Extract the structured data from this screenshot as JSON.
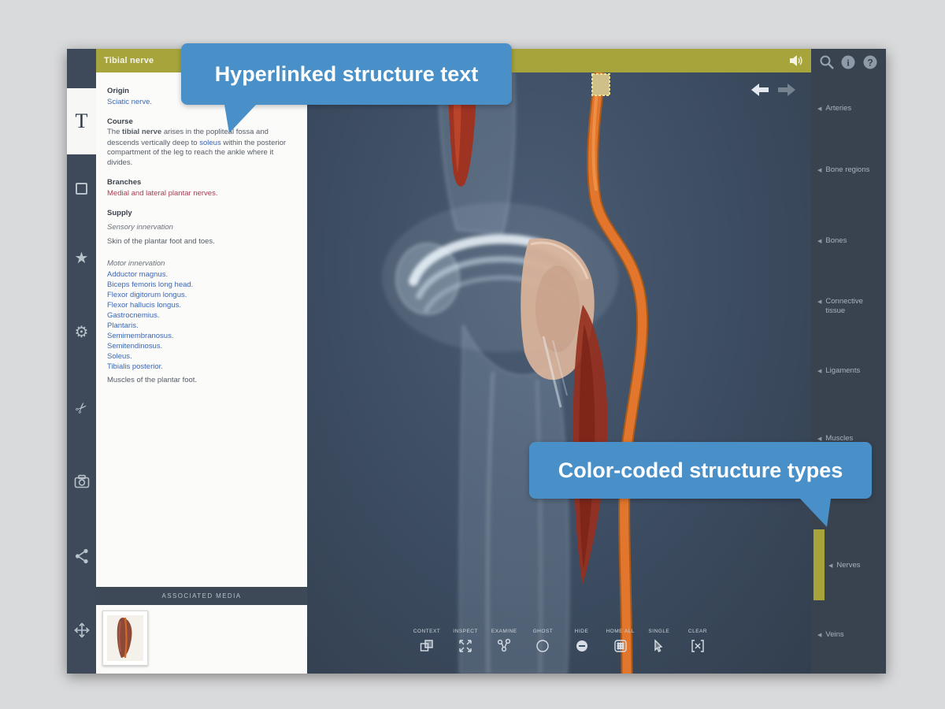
{
  "titlebar": {
    "title": "Tibial nerve"
  },
  "callouts": {
    "hyperlink": "Hyperlinked structure text",
    "color_coded": "Color-coded structure types"
  },
  "left_toolbar": {
    "text_tab": "T"
  },
  "glyphs": {
    "star": "★",
    "gear": "⚙",
    "scissors": "✂",
    "chevron": "◀"
  },
  "content": {
    "sections": {
      "origin": {
        "heading": "Origin",
        "link": "Sciatic nerve."
      },
      "course": {
        "heading": "Course",
        "pre": "The ",
        "bold": "tibial nerve",
        "mid": " arises in the popliteal fossa and descends vertically deep to ",
        "link": "soleus",
        "post": " within the posterior compartment of the leg to reach the ankle where it divides."
      },
      "branches": {
        "heading": "Branches",
        "link": "Medial and lateral plantar nerves."
      },
      "supply": {
        "heading": "Supply",
        "sensory_label": "Sensory innervation",
        "sensory_text": "Skin of the plantar foot and toes.",
        "motor_label": "Motor innervation",
        "motor_links": [
          "Adductor magnus.",
          "Biceps femoris long head.",
          "Flexor digitorum longus.",
          "Flexor hallucis longus.",
          "Gastrocnemius.",
          "Plantaris.",
          "Semimembranosus.",
          "Semitendinosus.",
          "Soleus.",
          "Tibialis posterior."
        ],
        "motor_text": "Muscles of the plantar foot."
      }
    },
    "associated_media_label": "ASSOCIATED MEDIA"
  },
  "structure_types": [
    {
      "label": "Arteries",
      "active": false
    },
    {
      "label": "Bone regions",
      "active": false
    },
    {
      "label": "Bones",
      "active": false
    },
    {
      "label": "Connective tissue",
      "active": false
    },
    {
      "label": "Ligaments",
      "active": false
    },
    {
      "label": "Muscles",
      "active": false
    },
    {
      "label": "Nerves",
      "active": true
    },
    {
      "label": "Veins",
      "active": false
    }
  ],
  "viewer_toolbar": [
    "CONTEXT",
    "INSPECT",
    "EXAMINE",
    "GHOST",
    "HIDE",
    "HOME ALL",
    "SINGLE",
    "CLEAR"
  ],
  "colors": {
    "accent_blue": "#4a90c8",
    "olive": "#a6a43b",
    "nerve_orange": "#e2762c",
    "link_blue": "#3a66b8",
    "link_maroon": "#a93d52"
  }
}
